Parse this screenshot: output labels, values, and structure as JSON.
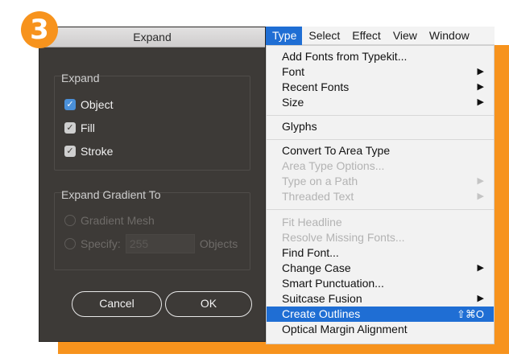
{
  "badge": {
    "number": "3",
    "color": "#f7931d"
  },
  "dialog": {
    "title": "Expand",
    "expand_group": {
      "title": "Expand",
      "options": [
        {
          "label": "Object",
          "checked": true,
          "style": "blue"
        },
        {
          "label": "Fill",
          "checked": true,
          "style": "gray"
        },
        {
          "label": "Stroke",
          "checked": true,
          "style": "gray"
        }
      ]
    },
    "gradient_group": {
      "title": "Expand Gradient To",
      "gradient_mesh_label": "Gradient Mesh",
      "specify_label": "Specify:",
      "specify_value": "255",
      "objects_label": "Objects"
    },
    "cancel_label": "Cancel",
    "ok_label": "OK"
  },
  "menubar": {
    "items": [
      "Type",
      "Select",
      "Effect",
      "View",
      "Window"
    ],
    "active": "Type"
  },
  "type_menu": {
    "items": [
      {
        "label": "Add Fonts from Typekit...",
        "arrow": ""
      },
      {
        "label": "Font",
        "arrow": "▶"
      },
      {
        "label": "Recent Fonts",
        "arrow": "▶"
      },
      {
        "label": "Size",
        "arrow": "▶"
      },
      {
        "label": "Glyphs",
        "arrow": ""
      },
      {
        "label": "Convert To Area Type",
        "arrow": ""
      },
      {
        "label": "Area Type Options...",
        "arrow": ""
      },
      {
        "label": "Type on a Path",
        "arrow": "▶"
      },
      {
        "label": "Threaded Text",
        "arrow": "▶"
      },
      {
        "label": "Fit Headline",
        "arrow": ""
      },
      {
        "label": "Resolve Missing Fonts...",
        "arrow": ""
      },
      {
        "label": "Find Font...",
        "arrow": ""
      },
      {
        "label": "Change Case",
        "arrow": "▶"
      },
      {
        "label": "Smart Punctuation...",
        "arrow": ""
      },
      {
        "label": "Suitcase Fusion",
        "arrow": "▶"
      },
      {
        "label": "Create Outlines",
        "shortcut": "⇧⌘O"
      },
      {
        "label": "Optical Margin Alignment",
        "arrow": ""
      }
    ],
    "highlighted": "Create Outlines",
    "accent": "#1f6ed4"
  }
}
